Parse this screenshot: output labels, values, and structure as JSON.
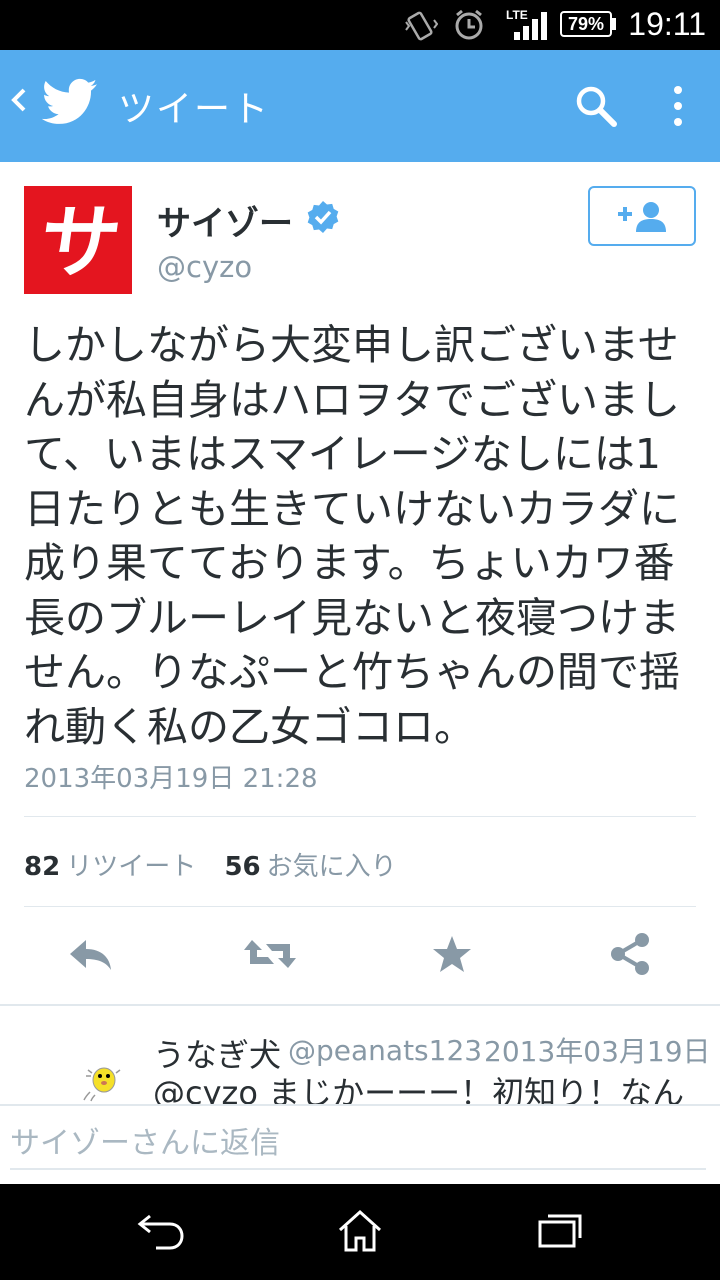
{
  "status_bar": {
    "network_type": "LTE",
    "battery": "79%",
    "clock": "19:11"
  },
  "app_bar": {
    "title": "ツイート"
  },
  "tweet": {
    "display_name": "サイゾー",
    "screen_name": "@cyzo",
    "avatar_text": "サ",
    "text": "しかしながら大変申し訳ございませんが私自身はハロヲタでございまして、いまはスマイレージなしには1日たりとも生きていけないカラダに成り果てております。ちょいカワ番長のブルーレイ見ないと夜寝つけません。りなぷーと竹ちゃんの間で揺れ動く私の乙女ゴコロ。",
    "timestamp": "2013年03月19日 21:28",
    "retweet_count": "82",
    "retweet_label": "リツイート",
    "favorite_count": "56",
    "favorite_label": "お気に入り"
  },
  "reply": {
    "name": "うなぎ犬",
    "handle": "@peanats123",
    "time": "2013年03月19日",
    "text": "@cyzo まじかーーー！初知り！なん"
  },
  "reply_box": {
    "placeholder": "サイゾーさんに返信"
  },
  "colors": {
    "twitter_blue": "#55acee",
    "brand_red": "#e4151f",
    "muted_gray": "#8899a6"
  }
}
